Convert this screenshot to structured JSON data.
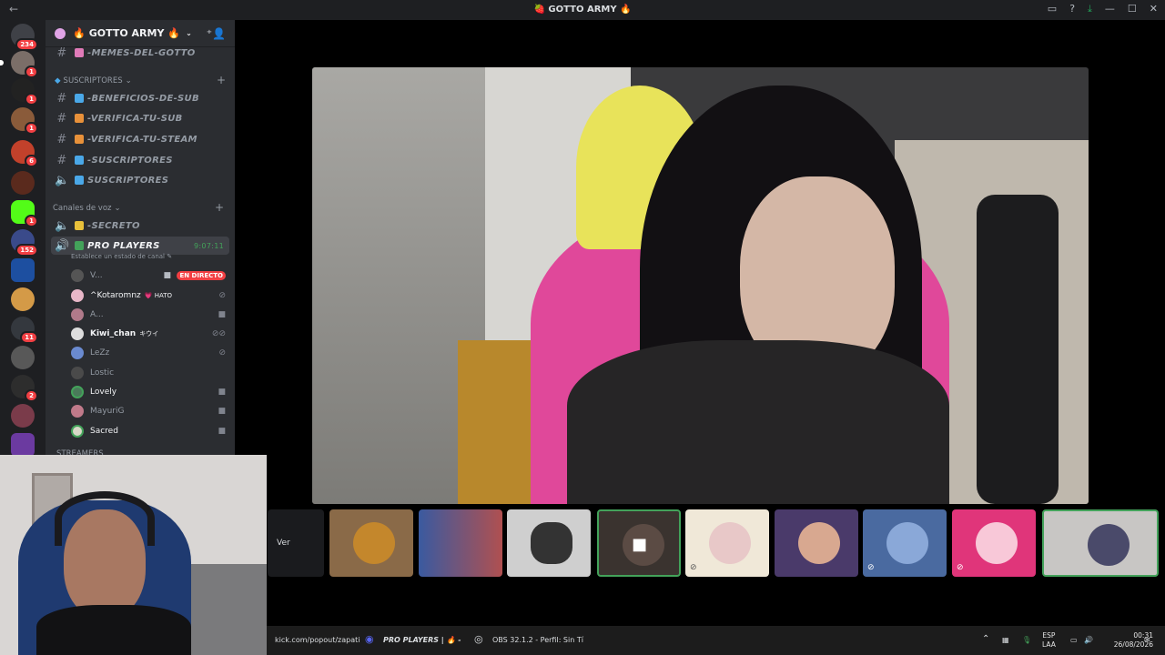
{
  "window": {
    "title": "🍓 GOTTO ARMY 🔥"
  },
  "server_rail": {
    "badges": [
      "234",
      "1",
      "1",
      "1",
      "6",
      "1",
      "152",
      "11",
      "2"
    ]
  },
  "guild": {
    "name": "GOTTO ARMY",
    "emoji_left": "🔥",
    "emoji_right": "🔥"
  },
  "channels": {
    "top": "-MEMES-DEL-GOTTO",
    "subs_category": "SUSCRIPTORES",
    "subs_channels": [
      "-BENEFICIOS-DE-SUB",
      "-VERIFICA-TU-SUB",
      "-VERIFICA-TU-STEAM",
      "-SUSCRIPTORES",
      "SUSCRIPTORES"
    ],
    "voice_category": "Canales de voz",
    "voice_channels": [
      "-SECRETO",
      "PRO PLAYERS"
    ],
    "active_time": "9:07:11",
    "status_prompt": "Establece un estado de canal",
    "next_category": "STREAMERS"
  },
  "voice_users": [
    {
      "name": "V...",
      "tag": "EN DIRECTO"
    },
    {
      "name": "^Kotaromnz",
      "tag": "HATO"
    },
    {
      "name": "A..."
    },
    {
      "name": "Kiwi_chan",
      "tag": "キウイ"
    },
    {
      "name": "LeZz"
    },
    {
      "name": "Lostic"
    },
    {
      "name": "Lovely"
    },
    {
      "name": "MayuriG"
    },
    {
      "name": "Sacred"
    }
  ],
  "strip": {
    "ver_label": "Ver"
  },
  "taskbar": {
    "browser_text": "kick.com/popout/zapati",
    "discord_text": "PRO PLAYERS | 🔥 -",
    "obs_text": "OBS 32.1.2 - Perfil: Sin Tí",
    "lang_top": "ESP",
    "lang_bottom": "LAA",
    "time": "00:31",
    "date": "26/08/2026"
  },
  "colors": {
    "live_red": "#f23f43",
    "online_green": "#43a25a",
    "sidebar_bg": "#2b2d31"
  }
}
